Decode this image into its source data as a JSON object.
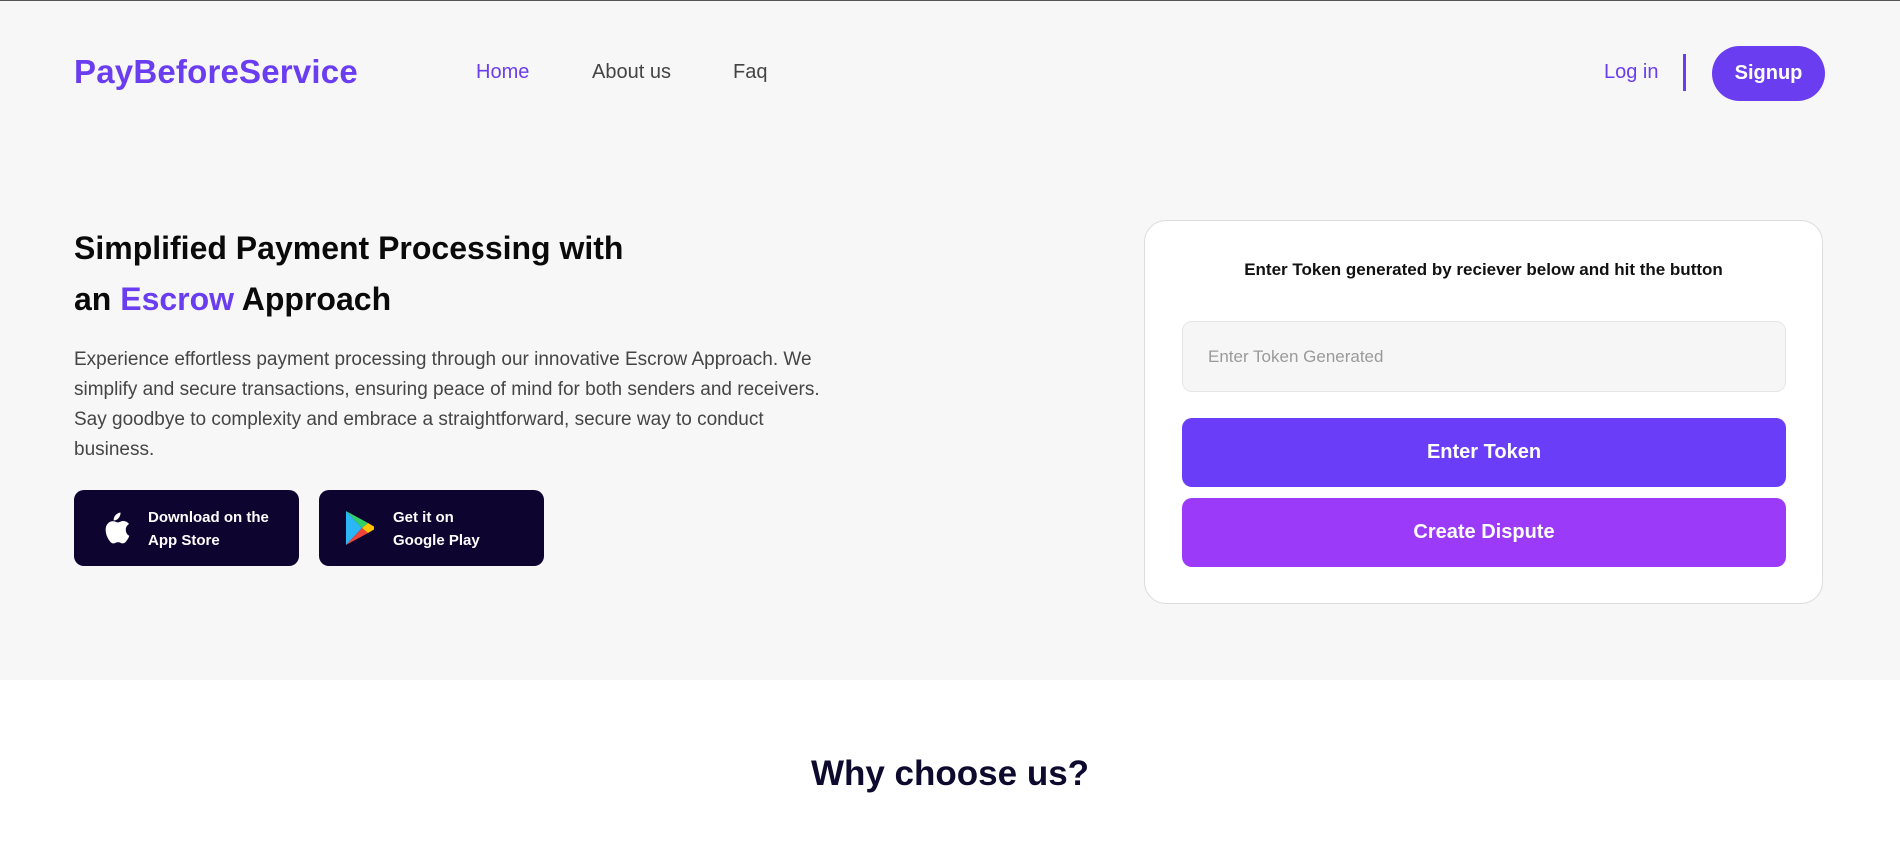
{
  "brand": {
    "name": "PayBeforeService",
    "color": "#6a3df0"
  },
  "nav": {
    "items": [
      {
        "label": "Home",
        "active": true
      },
      {
        "label": "About us",
        "active": false
      },
      {
        "label": "Faq",
        "active": false
      }
    ],
    "login_label": "Log in",
    "signup_label": "Signup"
  },
  "hero": {
    "headline_part1": "Simplified Payment Processing with",
    "headline_part2_prefix": "an ",
    "headline_accent": "Escrow",
    "headline_part2_suffix": " Approach",
    "description": "Experience effortless payment processing through our innovative Escrow Approach. We simplify and secure transactions, ensuring peace of mind for both senders and receivers. Say goodbye to complexity and embrace a straightforward, secure way to conduct business.",
    "app_store": {
      "line1": "Download on the",
      "line2": "App Store",
      "icon": "apple-icon"
    },
    "google_play": {
      "line1": "Get it on",
      "line2": "Google Play",
      "icon": "google-play-icon"
    }
  },
  "token_card": {
    "title": "Enter Token generated by reciever below and hit the button",
    "input_placeholder": "Enter Token Generated",
    "input_value": "",
    "enter_button": "Enter Token",
    "dispute_button": "Create Dispute",
    "colors": {
      "enter": "#6a3df9",
      "dispute": "#9b3af8"
    }
  },
  "section": {
    "why_title": "Why choose us?"
  }
}
